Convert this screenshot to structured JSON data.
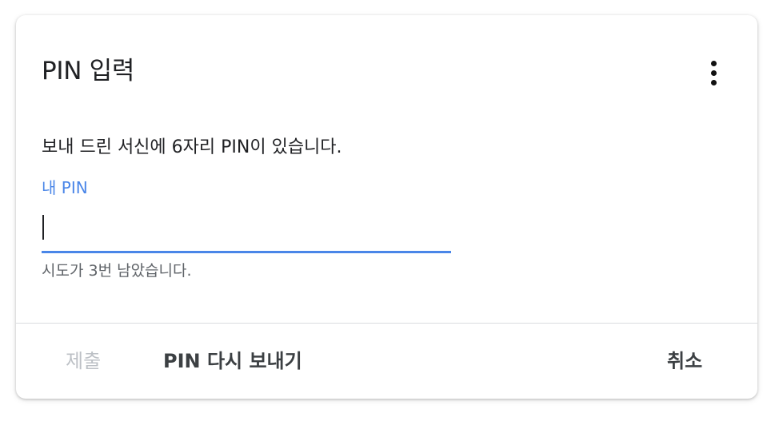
{
  "dialog": {
    "title": "PIN 입력",
    "description": "보내 드린 서신에 6자리 PIN이 있습니다.",
    "field": {
      "label": "내 PIN",
      "value": "",
      "placeholder": "",
      "helper": "시도가 3번 남았습니다."
    },
    "actions": {
      "submit_label": "제출",
      "resend_label": "PIN 다시 보내기",
      "cancel_label": "취소"
    },
    "more_icon": "more-vert-icon"
  },
  "colors": {
    "accent": "#4a86e8",
    "text": "#202124",
    "disabled": "#bdc1c6",
    "divider": "#dadce0"
  }
}
